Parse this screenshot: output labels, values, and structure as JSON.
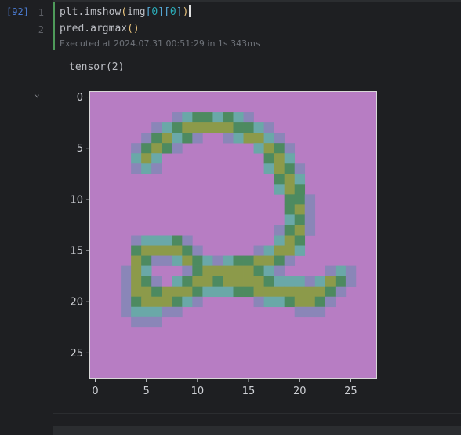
{
  "cell": {
    "execution_count": "[92]",
    "lines": [
      {
        "number": "1",
        "segments": [
          {
            "t": "plt.imshow",
            "c": ""
          },
          {
            "t": "(",
            "c": "paren"
          },
          {
            "t": "img",
            "c": ""
          },
          {
            "t": "[",
            "c": "brk"
          },
          {
            "t": "0",
            "c": "num"
          },
          {
            "t": "]",
            "c": "brk"
          },
          {
            "t": "[",
            "c": "brk"
          },
          {
            "t": "0",
            "c": "num"
          },
          {
            "t": "]",
            "c": "brk"
          },
          {
            "t": ")",
            "c": "paren"
          }
        ]
      },
      {
        "number": "2",
        "segments": [
          {
            "t": "pred.argmax",
            "c": ""
          },
          {
            "t": "()",
            "c": "paren"
          }
        ]
      }
    ],
    "exec_info": "Executed at 2024.07.31 00:51:29 in 1s 343ms"
  },
  "output": {
    "text": "tensor(2)",
    "collapse_icon": "chevron-down-icon"
  },
  "colors": {
    "background": "#b77dc3",
    "ink_dark": "#4d8a60",
    "ink_mid": "#8c9a4a",
    "ink_teal": "#6aa8a8",
    "ink_soft": "#8a86b8",
    "tick_color": "#cfd1d6"
  },
  "chart_data": {
    "type": "heatmap",
    "title": "",
    "xlabel": "",
    "ylabel": "",
    "x_ticks": [
      "0",
      "5",
      "10",
      "15",
      "20",
      "25"
    ],
    "y_ticks": [
      "0",
      "5",
      "10",
      "15",
      "20",
      "25"
    ],
    "xlim": [
      -0.5,
      27.5
    ],
    "ylim": [
      27.5,
      -0.5
    ],
    "image_size": [
      28,
      28
    ],
    "pixels": [
      {
        "r": 2,
        "c": 8,
        "k": "s"
      },
      {
        "r": 2,
        "c": 9,
        "k": "t"
      },
      {
        "r": 2,
        "c": 10,
        "k": "d"
      },
      {
        "r": 2,
        "c": 11,
        "k": "d"
      },
      {
        "r": 2,
        "c": 12,
        "k": "t"
      },
      {
        "r": 2,
        "c": 13,
        "k": "d"
      },
      {
        "r": 2,
        "c": 14,
        "k": "t"
      },
      {
        "r": 2,
        "c": 15,
        "k": "s"
      },
      {
        "r": 3,
        "c": 6,
        "k": "s"
      },
      {
        "r": 3,
        "c": 7,
        "k": "t"
      },
      {
        "r": 3,
        "c": 8,
        "k": "d"
      },
      {
        "r": 3,
        "c": 9,
        "k": "m"
      },
      {
        "r": 3,
        "c": 10,
        "k": "m"
      },
      {
        "r": 3,
        "c": 11,
        "k": "m"
      },
      {
        "r": 3,
        "c": 12,
        "k": "m"
      },
      {
        "r": 3,
        "c": 13,
        "k": "m"
      },
      {
        "r": 3,
        "c": 14,
        "k": "d"
      },
      {
        "r": 3,
        "c": 15,
        "k": "d"
      },
      {
        "r": 3,
        "c": 16,
        "k": "t"
      },
      {
        "r": 3,
        "c": 17,
        "k": "s"
      },
      {
        "r": 4,
        "c": 5,
        "k": "s"
      },
      {
        "r": 4,
        "c": 6,
        "k": "d"
      },
      {
        "r": 4,
        "c": 7,
        "k": "m"
      },
      {
        "r": 4,
        "c": 8,
        "k": "t"
      },
      {
        "r": 4,
        "c": 9,
        "k": "d"
      },
      {
        "r": 4,
        "c": 10,
        "k": "s"
      },
      {
        "r": 4,
        "c": 13,
        "k": "s"
      },
      {
        "r": 4,
        "c": 14,
        "k": "t"
      },
      {
        "r": 4,
        "c": 15,
        "k": "m"
      },
      {
        "r": 4,
        "c": 16,
        "k": "m"
      },
      {
        "r": 4,
        "c": 17,
        "k": "t"
      },
      {
        "r": 4,
        "c": 18,
        "k": "s"
      },
      {
        "r": 5,
        "c": 4,
        "k": "s"
      },
      {
        "r": 5,
        "c": 5,
        "k": "d"
      },
      {
        "r": 5,
        "c": 6,
        "k": "m"
      },
      {
        "r": 5,
        "c": 7,
        "k": "d"
      },
      {
        "r": 5,
        "c": 8,
        "k": "s"
      },
      {
        "r": 5,
        "c": 16,
        "k": "t"
      },
      {
        "r": 5,
        "c": 17,
        "k": "m"
      },
      {
        "r": 5,
        "c": 18,
        "k": "d"
      },
      {
        "r": 5,
        "c": 19,
        "k": "s"
      },
      {
        "r": 6,
        "c": 4,
        "k": "t"
      },
      {
        "r": 6,
        "c": 5,
        "k": "m"
      },
      {
        "r": 6,
        "c": 6,
        "k": "t"
      },
      {
        "r": 6,
        "c": 17,
        "k": "d"
      },
      {
        "r": 6,
        "c": 18,
        "k": "m"
      },
      {
        "r": 6,
        "c": 19,
        "k": "t"
      },
      {
        "r": 7,
        "c": 4,
        "k": "s"
      },
      {
        "r": 7,
        "c": 5,
        "k": "t"
      },
      {
        "r": 7,
        "c": 6,
        "k": "s"
      },
      {
        "r": 7,
        "c": 17,
        "k": "t"
      },
      {
        "r": 7,
        "c": 18,
        "k": "m"
      },
      {
        "r": 7,
        "c": 19,
        "k": "d"
      },
      {
        "r": 7,
        "c": 20,
        "k": "s"
      },
      {
        "r": 8,
        "c": 18,
        "k": "d"
      },
      {
        "r": 8,
        "c": 19,
        "k": "m"
      },
      {
        "r": 8,
        "c": 20,
        "k": "t"
      },
      {
        "r": 9,
        "c": 18,
        "k": "t"
      },
      {
        "r": 9,
        "c": 19,
        "k": "m"
      },
      {
        "r": 9,
        "c": 20,
        "k": "d"
      },
      {
        "r": 10,
        "c": 19,
        "k": "d"
      },
      {
        "r": 10,
        "c": 20,
        "k": "d"
      },
      {
        "r": 10,
        "c": 21,
        "k": "s"
      },
      {
        "r": 11,
        "c": 19,
        "k": "d"
      },
      {
        "r": 11,
        "c": 20,
        "k": "m"
      },
      {
        "r": 11,
        "c": 21,
        "k": "s"
      },
      {
        "r": 12,
        "c": 19,
        "k": "t"
      },
      {
        "r": 12,
        "c": 20,
        "k": "d"
      },
      {
        "r": 12,
        "c": 21,
        "k": "s"
      },
      {
        "r": 13,
        "c": 18,
        "k": "s"
      },
      {
        "r": 13,
        "c": 19,
        "k": "d"
      },
      {
        "r": 13,
        "c": 20,
        "k": "m"
      },
      {
        "r": 13,
        "c": 21,
        "k": "s"
      },
      {
        "r": 14,
        "c": 4,
        "k": "s"
      },
      {
        "r": 14,
        "c": 5,
        "k": "t"
      },
      {
        "r": 14,
        "c": 6,
        "k": "t"
      },
      {
        "r": 14,
        "c": 7,
        "k": "t"
      },
      {
        "r": 14,
        "c": 8,
        "k": "d"
      },
      {
        "r": 14,
        "c": 9,
        "k": "s"
      },
      {
        "r": 14,
        "c": 18,
        "k": "t"
      },
      {
        "r": 14,
        "c": 19,
        "k": "m"
      },
      {
        "r": 14,
        "c": 20,
        "k": "d"
      },
      {
        "r": 15,
        "c": 4,
        "k": "d"
      },
      {
        "r": 15,
        "c": 5,
        "k": "m"
      },
      {
        "r": 15,
        "c": 6,
        "k": "m"
      },
      {
        "r": 15,
        "c": 7,
        "k": "m"
      },
      {
        "r": 15,
        "c": 8,
        "k": "m"
      },
      {
        "r": 15,
        "c": 9,
        "k": "d"
      },
      {
        "r": 15,
        "c": 10,
        "k": "s"
      },
      {
        "r": 15,
        "c": 16,
        "k": "s"
      },
      {
        "r": 15,
        "c": 17,
        "k": "t"
      },
      {
        "r": 15,
        "c": 18,
        "k": "m"
      },
      {
        "r": 15,
        "c": 19,
        "k": "m"
      },
      {
        "r": 15,
        "c": 20,
        "k": "t"
      },
      {
        "r": 16,
        "c": 4,
        "k": "m"
      },
      {
        "r": 16,
        "c": 5,
        "k": "d"
      },
      {
        "r": 16,
        "c": 6,
        "k": "s"
      },
      {
        "r": 16,
        "c": 7,
        "k": "s"
      },
      {
        "r": 16,
        "c": 8,
        "k": "t"
      },
      {
        "r": 16,
        "c": 9,
        "k": "m"
      },
      {
        "r": 16,
        "c": 10,
        "k": "d"
      },
      {
        "r": 16,
        "c": 11,
        "k": "t"
      },
      {
        "r": 16,
        "c": 12,
        "k": "s"
      },
      {
        "r": 16,
        "c": 13,
        "k": "t"
      },
      {
        "r": 16,
        "c": 14,
        "k": "d"
      },
      {
        "r": 16,
        "c": 15,
        "k": "d"
      },
      {
        "r": 16,
        "c": 16,
        "k": "m"
      },
      {
        "r": 16,
        "c": 17,
        "k": "m"
      },
      {
        "r": 16,
        "c": 18,
        "k": "d"
      },
      {
        "r": 16,
        "c": 19,
        "k": "s"
      },
      {
        "r": 17,
        "c": 3,
        "k": "s"
      },
      {
        "r": 17,
        "c": 4,
        "k": "m"
      },
      {
        "r": 17,
        "c": 5,
        "k": "t"
      },
      {
        "r": 17,
        "c": 9,
        "k": "s"
      },
      {
        "r": 17,
        "c": 10,
        "k": "d"
      },
      {
        "r": 17,
        "c": 11,
        "k": "m"
      },
      {
        "r": 17,
        "c": 12,
        "k": "m"
      },
      {
        "r": 17,
        "c": 13,
        "k": "m"
      },
      {
        "r": 17,
        "c": 14,
        "k": "m"
      },
      {
        "r": 17,
        "c": 15,
        "k": "m"
      },
      {
        "r": 17,
        "c": 16,
        "k": "d"
      },
      {
        "r": 17,
        "c": 17,
        "k": "t"
      },
      {
        "r": 17,
        "c": 18,
        "k": "s"
      },
      {
        "r": 17,
        "c": 23,
        "k": "s"
      },
      {
        "r": 17,
        "c": 24,
        "k": "t"
      },
      {
        "r": 17,
        "c": 25,
        "k": "s"
      },
      {
        "r": 18,
        "c": 3,
        "k": "s"
      },
      {
        "r": 18,
        "c": 4,
        "k": "m"
      },
      {
        "r": 18,
        "c": 5,
        "k": "d"
      },
      {
        "r": 18,
        "c": 6,
        "k": "s"
      },
      {
        "r": 18,
        "c": 8,
        "k": "t"
      },
      {
        "r": 18,
        "c": 9,
        "k": "d"
      },
      {
        "r": 18,
        "c": 10,
        "k": "m"
      },
      {
        "r": 18,
        "c": 11,
        "k": "m"
      },
      {
        "r": 18,
        "c": 12,
        "k": "d"
      },
      {
        "r": 18,
        "c": 13,
        "k": "m"
      },
      {
        "r": 18,
        "c": 14,
        "k": "m"
      },
      {
        "r": 18,
        "c": 15,
        "k": "m"
      },
      {
        "r": 18,
        "c": 16,
        "k": "m"
      },
      {
        "r": 18,
        "c": 17,
        "k": "d"
      },
      {
        "r": 18,
        "c": 18,
        "k": "t"
      },
      {
        "r": 18,
        "c": 19,
        "k": "t"
      },
      {
        "r": 18,
        "c": 20,
        "k": "t"
      },
      {
        "r": 18,
        "c": 21,
        "k": "s"
      },
      {
        "r": 18,
        "c": 22,
        "k": "t"
      },
      {
        "r": 18,
        "c": 23,
        "k": "m"
      },
      {
        "r": 18,
        "c": 24,
        "k": "d"
      },
      {
        "r": 18,
        "c": 25,
        "k": "s"
      },
      {
        "r": 19,
        "c": 3,
        "k": "s"
      },
      {
        "r": 19,
        "c": 4,
        "k": "m"
      },
      {
        "r": 19,
        "c": 5,
        "k": "m"
      },
      {
        "r": 19,
        "c": 6,
        "k": "d"
      },
      {
        "r": 19,
        "c": 7,
        "k": "m"
      },
      {
        "r": 19,
        "c": 8,
        "k": "m"
      },
      {
        "r": 19,
        "c": 9,
        "k": "m"
      },
      {
        "r": 19,
        "c": 10,
        "k": "d"
      },
      {
        "r": 19,
        "c": 11,
        "k": "t"
      },
      {
        "r": 19,
        "c": 12,
        "k": "t"
      },
      {
        "r": 19,
        "c": 13,
        "k": "t"
      },
      {
        "r": 19,
        "c": 14,
        "k": "d"
      },
      {
        "r": 19,
        "c": 15,
        "k": "d"
      },
      {
        "r": 19,
        "c": 16,
        "k": "m"
      },
      {
        "r": 19,
        "c": 17,
        "k": "m"
      },
      {
        "r": 19,
        "c": 18,
        "k": "m"
      },
      {
        "r": 19,
        "c": 19,
        "k": "m"
      },
      {
        "r": 19,
        "c": 20,
        "k": "m"
      },
      {
        "r": 19,
        "c": 21,
        "k": "m"
      },
      {
        "r": 19,
        "c": 22,
        "k": "m"
      },
      {
        "r": 19,
        "c": 23,
        "k": "d"
      },
      {
        "r": 19,
        "c": 24,
        "k": "s"
      },
      {
        "r": 20,
        "c": 3,
        "k": "s"
      },
      {
        "r": 20,
        "c": 4,
        "k": "d"
      },
      {
        "r": 20,
        "c": 5,
        "k": "m"
      },
      {
        "r": 20,
        "c": 6,
        "k": "m"
      },
      {
        "r": 20,
        "c": 7,
        "k": "m"
      },
      {
        "r": 20,
        "c": 8,
        "k": "d"
      },
      {
        "r": 20,
        "c": 9,
        "k": "t"
      },
      {
        "r": 20,
        "c": 10,
        "k": "s"
      },
      {
        "r": 20,
        "c": 16,
        "k": "s"
      },
      {
        "r": 20,
        "c": 17,
        "k": "t"
      },
      {
        "r": 20,
        "c": 18,
        "k": "t"
      },
      {
        "r": 20,
        "c": 19,
        "k": "d"
      },
      {
        "r": 20,
        "c": 20,
        "k": "m"
      },
      {
        "r": 20,
        "c": 21,
        "k": "m"
      },
      {
        "r": 20,
        "c": 22,
        "k": "d"
      },
      {
        "r": 20,
        "c": 23,
        "k": "s"
      },
      {
        "r": 21,
        "c": 3,
        "k": "s"
      },
      {
        "r": 21,
        "c": 4,
        "k": "t"
      },
      {
        "r": 21,
        "c": 5,
        "k": "t"
      },
      {
        "r": 21,
        "c": 6,
        "k": "t"
      },
      {
        "r": 21,
        "c": 7,
        "k": "s"
      },
      {
        "r": 21,
        "c": 8,
        "k": "s"
      },
      {
        "r": 21,
        "c": 20,
        "k": "s"
      },
      {
        "r": 21,
        "c": 21,
        "k": "s"
      },
      {
        "r": 21,
        "c": 22,
        "k": "s"
      },
      {
        "r": 22,
        "c": 4,
        "k": "s"
      },
      {
        "r": 22,
        "c": 5,
        "k": "s"
      },
      {
        "r": 22,
        "c": 6,
        "k": "s"
      }
    ]
  }
}
